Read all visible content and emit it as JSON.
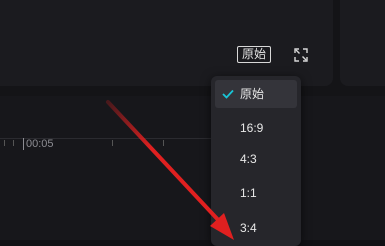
{
  "player": {
    "aspect_ratio_label": "原始",
    "fullscreen_icon": "fullscreen-icon"
  },
  "timeline": {
    "time_marker": "00:05"
  },
  "aspect_menu": {
    "selected_index": 0,
    "check_icon": "check-icon",
    "items": [
      {
        "label": "原始"
      },
      {
        "label": "16:9"
      },
      {
        "label": "4:3"
      },
      {
        "label": "1:1"
      },
      {
        "label": "3:4"
      }
    ]
  },
  "colors": {
    "accent": "#18c6d8",
    "annotation_arrow": "#e02020",
    "menu_bg": "#26262b",
    "app_bg": "#101014"
  }
}
